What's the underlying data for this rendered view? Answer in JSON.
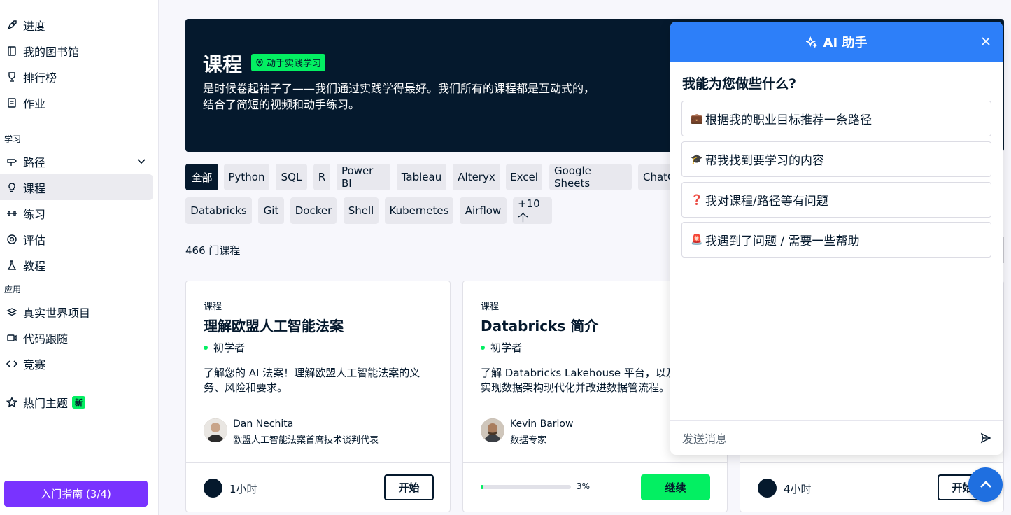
{
  "sidebar": {
    "top_items": [
      {
        "label": "进度",
        "icon": "rocket-icon"
      },
      {
        "label": "我的图书馆",
        "icon": "book-icon"
      },
      {
        "label": "排行榜",
        "icon": "trophy-icon"
      },
      {
        "label": "作业",
        "icon": "document-icon"
      }
    ],
    "section_learn": "学习",
    "learn_items": [
      {
        "label": "路径",
        "icon": "signpost-icon"
      },
      {
        "label": "课程",
        "icon": "lightbulb-icon",
        "active": true
      },
      {
        "label": "练习",
        "icon": "dumbbell-icon"
      },
      {
        "label": "评估",
        "icon": "gauge-icon"
      },
      {
        "label": "教程",
        "icon": "flask-icon"
      }
    ],
    "section_apply": "应用",
    "apply_items": [
      {
        "label": "真实世界项目",
        "icon": "layers-icon"
      },
      {
        "label": "代码跟随",
        "icon": "video-icon"
      },
      {
        "label": "竞赛",
        "icon": "code-icon"
      }
    ],
    "hot_topics": {
      "label": "热门主题",
      "badge": "新",
      "icon": "star-icon"
    },
    "guide_button": "入门指南 (3/4)"
  },
  "hero": {
    "title": "课程",
    "tag": "动手实践学习",
    "description": "是时候卷起袖子了——我们通过实践学得最好。我们所有的课程都是互动式的，结合了简短的视频和动手练习。"
  },
  "filters": {
    "row1": [
      "全部",
      "Python",
      "SQL",
      "R",
      "Power BI",
      "Tableau",
      "Alteryx",
      "Excel",
      "Google Sheets",
      "ChatG"
    ],
    "row2": [
      "Databricks",
      "Git",
      "Docker",
      "Shell",
      "Kubernetes",
      "Airflow",
      "+10个"
    ],
    "active": "全部"
  },
  "course_count": "466 门课程",
  "cards": [
    {
      "type": "课程",
      "title": "理解欧盟人工智能法案",
      "level": "初学者",
      "description": "了解您的 AI 法案！理解欧盟人工智能法案的义务、风险和要求。",
      "author": "Dan Nechita",
      "author_role": "欧盟人工智能法案首席技术谈判代表",
      "duration": "1小时",
      "action": "开始"
    },
    {
      "type": "课程",
      "title": "Databricks 简介",
      "level": "初学者",
      "description": "了解 Databricks Lakehouse 平台，以及它如何实现数据架构现代化并改进数据管流程。",
      "author": "Kevin Barlow",
      "author_role": "数据专家",
      "progress": 3,
      "progress_label": "3%",
      "action": "继续"
    },
    {
      "duration": "4小时",
      "action": "开始"
    }
  ],
  "ai_panel": {
    "title": "AI 助手",
    "question": "我能为您做些什么?",
    "options": [
      {
        "emoji": "💼",
        "label": "根据我的职业目标推荐一条路径"
      },
      {
        "emoji": "🎓",
        "label": "帮我找到要学习的内容"
      },
      {
        "emoji": "❓",
        "label": "我对课程/路径等有问题"
      },
      {
        "emoji": "🚨",
        "label": "我遇到了问题 / 需要一些帮助"
      }
    ],
    "input_placeholder": "发送消息"
  },
  "colors": {
    "brand_green": "#03ef62",
    "navy": "#05192d",
    "ai_blue": "#2d7ff9",
    "purple": "#7933ff"
  }
}
